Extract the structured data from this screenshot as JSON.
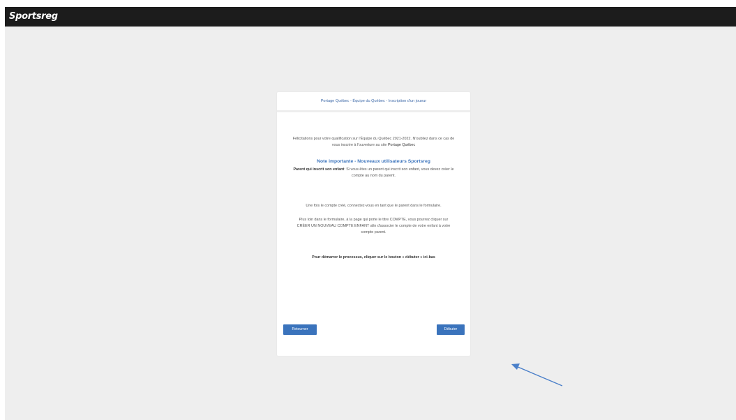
{
  "app": {
    "brand": "Sportsreg"
  },
  "card": {
    "header": "Portage Québec - Équipe du Québec - Inscription d'un joueur",
    "intro_text": "Félicitations pour votre qualification sur l'Équipe du Québec 2021-2022. N'oubliez dans ce cas de vous inscrire à l'ouverture au site",
    "intro_strong": "Portage Québec",
    "important_title": "Note importante - Nouveaux utilisateurs Sportsreg",
    "parent_bold": "Parent qui inscrit son enfant",
    "parent_text": ": Si vous êtes un parent qui inscrit son enfant, vous devez créer le compte au nom du parent.",
    "once_text": "Une fois le compte créé, connectez-vous en tant que le parent dans le formulaire.",
    "register_text": "Plus loin dans le formulaire, à la page qui porte le titre COMPTE, vous pourrez cliquer sur CRÉER UN NOUVEAU COMPTE ENFANT afin d'associer le compte de votre enfant à votre compte parent.",
    "start_text": "Pour démarrer le processus, cliquer sur le bouton « débuter » ici-bas",
    "back_button": "Retourner",
    "start_button": "Débuter"
  },
  "annotation": {
    "arrow_color": "#4a7fc9",
    "arrow_icon": "arrow-pointer"
  }
}
